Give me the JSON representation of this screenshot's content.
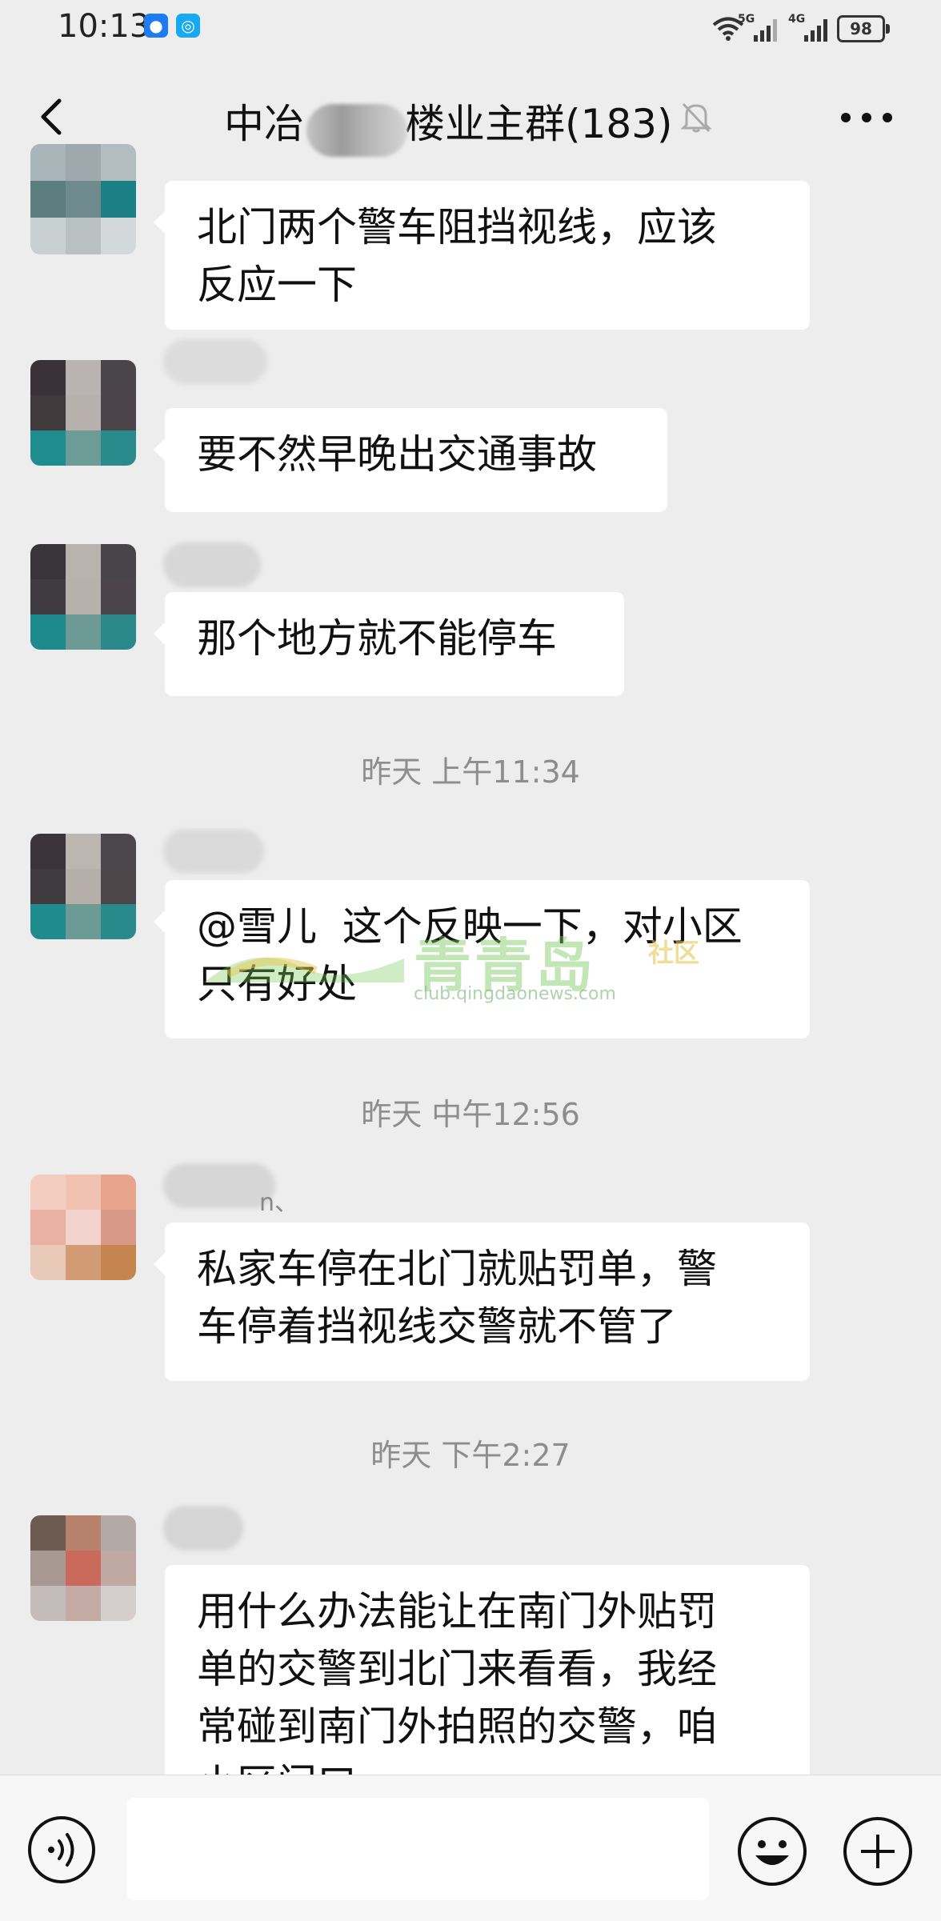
{
  "status_bar": {
    "time": "10:13",
    "network_5g": "5G",
    "network_4g": "4G",
    "battery": "98"
  },
  "header": {
    "title_prefix": "中冶",
    "title_suffix": "楼业主群(183)",
    "muted": true
  },
  "messages": [
    {
      "text": "北门两个警车阻挡视线，应该\n反应一下"
    },
    {
      "text": "要不然早晚出交通事故"
    },
    {
      "text": "那个地方就不能停车"
    },
    {
      "text": "@雪儿  这个反映一下，对小区\n只有好处"
    },
    {
      "sender_suffix": "n、",
      "text": "私家车停在北门就贴罚单，警\n车停着挡视线交警就不管了"
    },
    {
      "text": "用什么办法能让在南门外贴罚\n单的交警到北门来看看，我经\n常碰到南门外拍照的交警，咱\n小区门口..."
    }
  ],
  "timestamps": [
    "昨天 上午11:34",
    "昨天 中午12:56",
    "昨天 下午2:27"
  ],
  "watermark": {
    "brand": "青青岛",
    "tag": "社区",
    "url": "club.qingdaonews.com"
  },
  "input": {
    "placeholder": ""
  },
  "colors": {
    "background": "#ededed",
    "bubble": "#ffffff",
    "timestamp": "#8d8d8d"
  }
}
